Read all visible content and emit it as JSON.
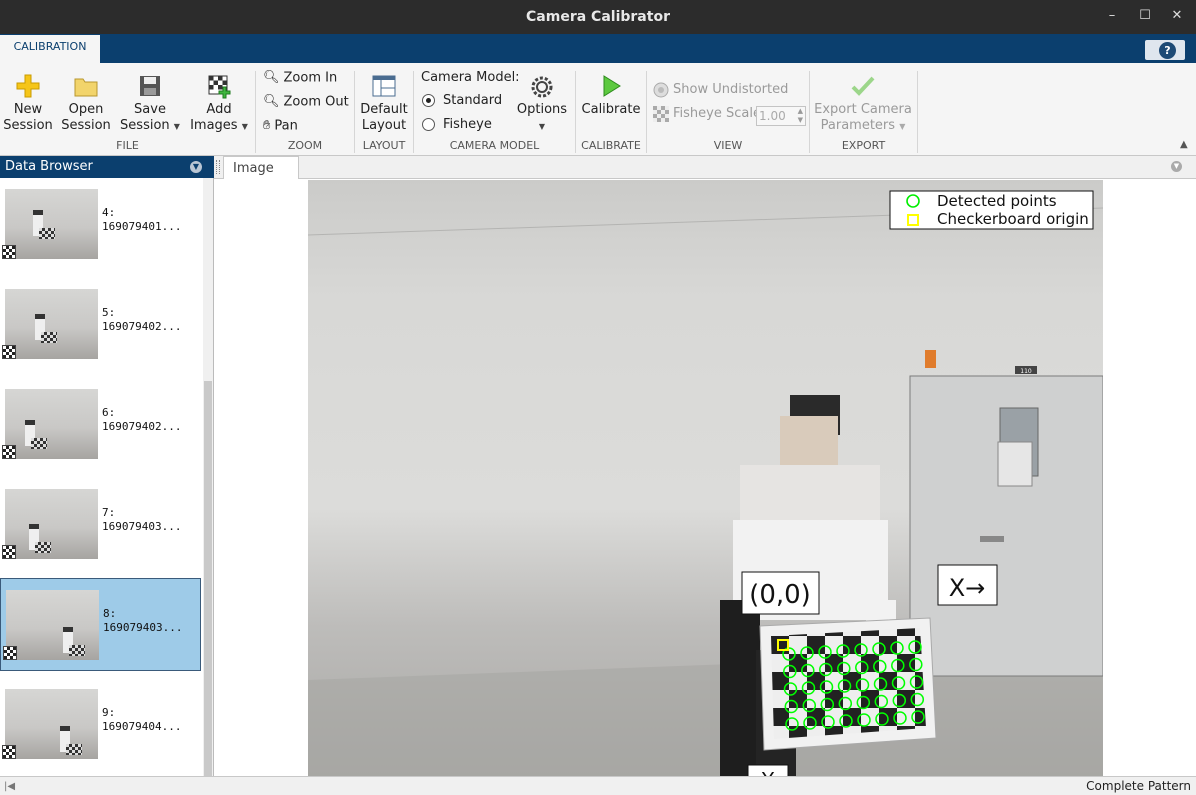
{
  "window": {
    "title": "Camera Calibrator"
  },
  "ribbon": {
    "tab": "CALIBRATION",
    "file": {
      "new_session": [
        "New",
        "Session"
      ],
      "open_session": [
        "Open",
        "Session"
      ],
      "save_session": [
        "Save",
        "Session"
      ],
      "add_images": [
        "Add",
        "Images"
      ],
      "group": "FILE"
    },
    "zoom": {
      "zoom_in": "Zoom In",
      "zoom_out": "Zoom Out",
      "pan": "Pan",
      "group": "ZOOM"
    },
    "layout": {
      "default_layout": [
        "Default",
        "Layout"
      ],
      "group": "LAYOUT"
    },
    "camera_model": {
      "label": "Camera Model:",
      "standard": "Standard",
      "fisheye": "Fisheye",
      "selected": "Standard",
      "options": "Options",
      "group": "CAMERA MODEL"
    },
    "calibrate": {
      "calibrate": "Calibrate",
      "group": "CALIBRATE"
    },
    "view": {
      "show_undistorted": "Show Undistorted",
      "fisheye_scale_label": "Fisheye Scale",
      "fisheye_scale_value": "1.00",
      "group": "VIEW"
    },
    "export": {
      "export_params": [
        "Export Camera",
        "Parameters"
      ],
      "group": "EXPORT"
    }
  },
  "data_browser": {
    "title": "Data Browser",
    "items": [
      {
        "index": "4:",
        "name": "169079401..."
      },
      {
        "index": "5:",
        "name": "169079402..."
      },
      {
        "index": "6:",
        "name": "169079402..."
      },
      {
        "index": "7:",
        "name": "169079403..."
      },
      {
        "index": "8:",
        "name": "169079403...",
        "selected": true
      },
      {
        "index": "9:",
        "name": "169079404..."
      }
    ]
  },
  "document": {
    "tab": "Image"
  },
  "image": {
    "legend": {
      "detected": "Detected points",
      "origin": "Checkerboard origin"
    },
    "origin_label": "(0,0)",
    "x_axis_label": "X→",
    "y_axis_label": "Y",
    "door_sign": "110"
  },
  "status": {
    "message": "Complete Pattern"
  },
  "colors": {
    "accent": "#0b3f6e",
    "detected": "#00ff00",
    "origin": "#ffff00",
    "selection": "#9ecbe8"
  }
}
